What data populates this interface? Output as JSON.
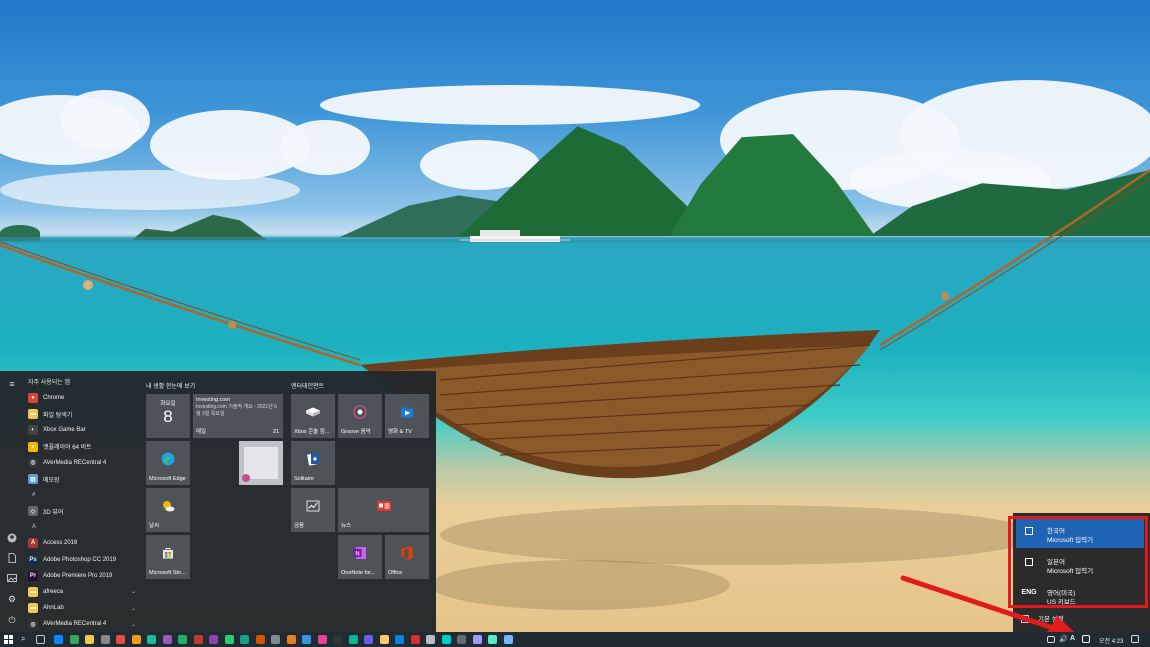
{
  "start_menu": {
    "app_list": {
      "header": "자주 사용되는 앱",
      "items": [
        {
          "label": "Chrome",
          "color": "#db4437",
          "glyph": "●"
        },
        {
          "label": "파일 탐색기",
          "color": "#f2c94c",
          "glyph": "▬"
        },
        {
          "label": "Xbox Game Bar",
          "color": "#444444",
          "glyph": "◐"
        },
        {
          "label": "맷플레이어 64 비트",
          "color": "#f5b800",
          "glyph": "●"
        },
        {
          "label": "AVerMedia RECentral 4",
          "color": "#333333",
          "glyph": "◎"
        },
        {
          "label": "메모장",
          "color": "#5b9bd5",
          "glyph": "▤"
        }
      ],
      "sections": [
        {
          "letter": "#",
          "items": [
            {
              "label": "3D 뷰어",
              "color": "#666666",
              "glyph": "◇"
            }
          ]
        },
        {
          "letter": "A",
          "items": [
            {
              "label": "Access 2016",
              "color": "#a4373a",
              "glyph": "A"
            },
            {
              "label": "Adobe Photoshop CC 2019",
              "color": "#0f2e52",
              "glyph": "Ps"
            },
            {
              "label": "Adobe Premiere Pro 2019",
              "color": "#2b0a3d",
              "glyph": "Pr"
            },
            {
              "label": "afreeca",
              "color": "#f2c94c",
              "glyph": "▬",
              "expand": true
            },
            {
              "label": "AhnLab",
              "color": "#f2c94c",
              "glyph": "▬",
              "expand": true
            },
            {
              "label": "AVerMedia RECentral 4",
              "color": "#333333",
              "glyph": "◎",
              "expand": true
            }
          ]
        }
      ]
    },
    "groups": {
      "life": "내 생활 한눈에 보기",
      "play": "엔터테인먼트"
    },
    "tiles": {
      "calendar": {
        "day_name": "화요일",
        "day": "8"
      },
      "mail": {
        "source": "Investing.com",
        "text": "Investing.com 기술적 개요 - 2021년 6월 3일 목요일",
        "app": "메일",
        "count": "21"
      },
      "edge": "Microsoft Edge",
      "weather": "날씨",
      "store": "Microsoft Sto...",
      "xbox": "Xbox 콘솔 컴...",
      "groove": "Groove 음악",
      "movies": "영화 & TV",
      "solitaire": "Solitaire",
      "finance": "금융",
      "news": "뉴스",
      "onenote": "OneNote for...",
      "office": "Office"
    }
  },
  "language_flyout": {
    "items": [
      {
        "code": "",
        "name": "한국어",
        "sub": "Microsoft 입력기",
        "selected": true
      },
      {
        "code": "",
        "name": "일본어",
        "sub": "Microsoft 입력기",
        "selected": false
      },
      {
        "code": "ENG",
        "name": "영어(미국)",
        "sub": "US 키보드",
        "selected": false
      }
    ],
    "preferences": "기본 설정"
  },
  "taskbar": {
    "ime_indicator": "A",
    "clock": "오전 4:23"
  }
}
